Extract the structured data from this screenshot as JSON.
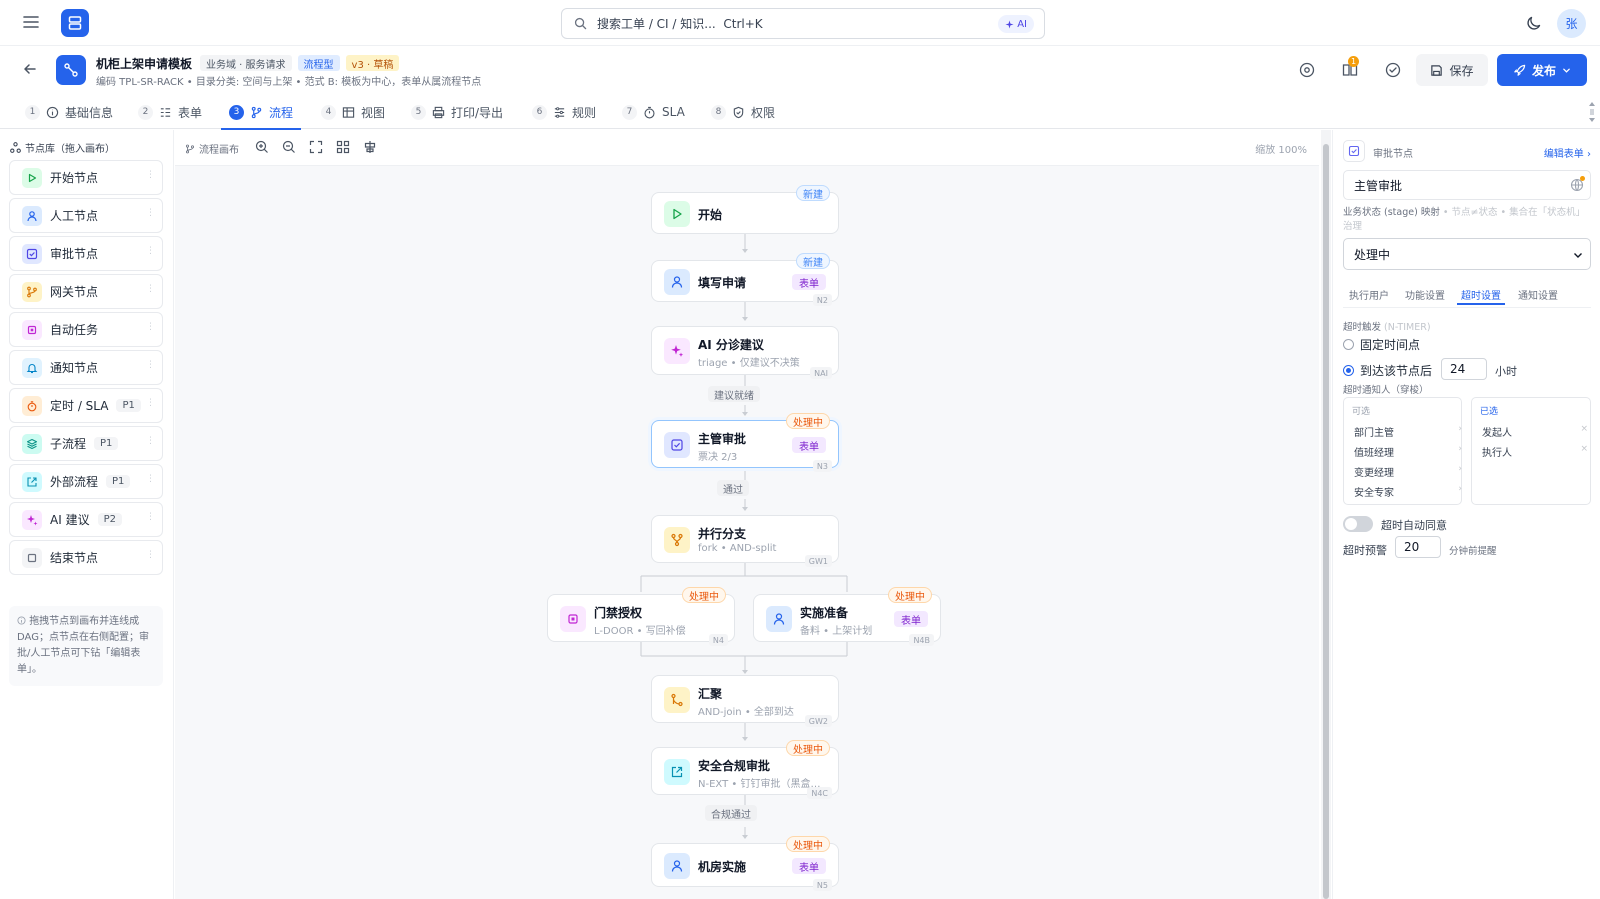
{
  "topbar": {
    "search_placeholder": "搜索工单 / CI / 知识...",
    "search_shortcut": "Ctrl+K",
    "ai_chip": "AI",
    "avatar_initial": "张"
  },
  "header": {
    "title": "机柜上架申请模板",
    "tags": [
      "业务域 · 服务请求",
      "流程型",
      "v3 · 草稿"
    ],
    "subtitle": "编码 TPL-SR-RACK • 目录分类: 空间与上架 • 范式 B: 模板为中心，表单从属流程节点",
    "notification_count": "1",
    "save_label": "保存",
    "publish_label": "发布"
  },
  "tabs": [
    {
      "num": "1",
      "label": "基础信息"
    },
    {
      "num": "2",
      "label": "表单"
    },
    {
      "num": "3",
      "label": "流程"
    },
    {
      "num": "4",
      "label": "视图"
    },
    {
      "num": "5",
      "label": "打印/导出"
    },
    {
      "num": "6",
      "label": "规则"
    },
    {
      "num": "7",
      "label": "SLA"
    },
    {
      "num": "8",
      "label": "权限"
    }
  ],
  "sidebar": {
    "title": "节点库（拖入画布）",
    "items": [
      {
        "label": "开始节点",
        "badge": ""
      },
      {
        "label": "人工节点",
        "badge": ""
      },
      {
        "label": "审批节点",
        "badge": ""
      },
      {
        "label": "网关节点",
        "badge": ""
      },
      {
        "label": "自动任务",
        "badge": ""
      },
      {
        "label": "通知节点",
        "badge": ""
      },
      {
        "label": "定时 / SLA",
        "badge": "P1"
      },
      {
        "label": "子流程",
        "badge": "P1"
      },
      {
        "label": "外部流程",
        "badge": "P1"
      },
      {
        "label": "AI 建议",
        "badge": "P2"
      },
      {
        "label": "结束节点",
        "badge": ""
      }
    ],
    "hint": "拖拽节点到画布并连线成 DAG；点节点在右侧配置；审批/人工节点可下钻「编辑表单」。"
  },
  "canvas": {
    "toolbar_label": "流程画布",
    "zoom_label": "缩放 100%",
    "nodes": [
      {
        "name": "开始",
        "sub": "",
        "status": "新建",
        "form": "",
        "code": ""
      },
      {
        "name": "填写申请",
        "sub": "",
        "status": "新建",
        "form": "表单",
        "code": "N2"
      },
      {
        "name": "AI 分诊建议",
        "sub": "triage • 仅建议不决策",
        "status": "",
        "form": "",
        "code": "NAI"
      },
      {
        "name": "主管审批",
        "sub": "票决 2/3",
        "status": "处理中",
        "form": "表单",
        "code": "N3"
      },
      {
        "name": "并行分支",
        "sub": "fork • AND-split",
        "status": "",
        "form": "",
        "code": "GW1"
      },
      {
        "name": "门禁授权",
        "sub": "L-DOOR • 写回补偿",
        "status": "处理中",
        "form": "",
        "code": "N4"
      },
      {
        "name": "实施准备",
        "sub": "备料 • 上架计划",
        "status": "处理中",
        "form": "表单",
        "code": "N4B"
      },
      {
        "name": "汇聚",
        "sub": "AND-join • 全部到达",
        "status": "",
        "form": "",
        "code": "GW2"
      },
      {
        "name": "安全合规审批",
        "sub": "N-EXT • 钉钉审批（黑盒…",
        "status": "处理中",
        "form": "",
        "code": "N4C"
      },
      {
        "name": "机房实施",
        "sub": "",
        "status": "处理中",
        "form": "表单",
        "code": "N5"
      }
    ],
    "edge_labels": [
      "建议就绪",
      "通过",
      "合规通过"
    ]
  },
  "panel": {
    "node_type": "审批节点",
    "edit_form_link": "编辑表单",
    "node_name": "主管审批",
    "stage_label": "业务状态 (stage) 映射",
    "stage_hint": "• 节点≠状态 • 集合在「状态机」治理",
    "stage_value": "处理中",
    "tabs": [
      "执行用户",
      "功能设置",
      "超时设置",
      "通知设置"
    ],
    "timeout_trigger_label": "超时触发",
    "timeout_trigger_hint": "(N-TIMER)",
    "radio_fixed": "固定时间点",
    "radio_after": "到达该节点后",
    "after_value": "24",
    "after_unit": "小时",
    "notify_label": "超时通知人（穿梭）",
    "available_title": "可选",
    "available": [
      "部门主管",
      "值班经理",
      "变更经理",
      "安全专家"
    ],
    "selected_title": "已选",
    "selected": [
      "发起人",
      "执行人"
    ],
    "auto_agree_label": "超时自动同意",
    "warn_label": "超时预警",
    "warn_value": "20",
    "warn_unit": "分钟前提醒"
  },
  "colors": {
    "accent": "#2563eb",
    "processing": "#ea580c",
    "new": "#3b82f6",
    "form_tag": "#7e22ce"
  }
}
